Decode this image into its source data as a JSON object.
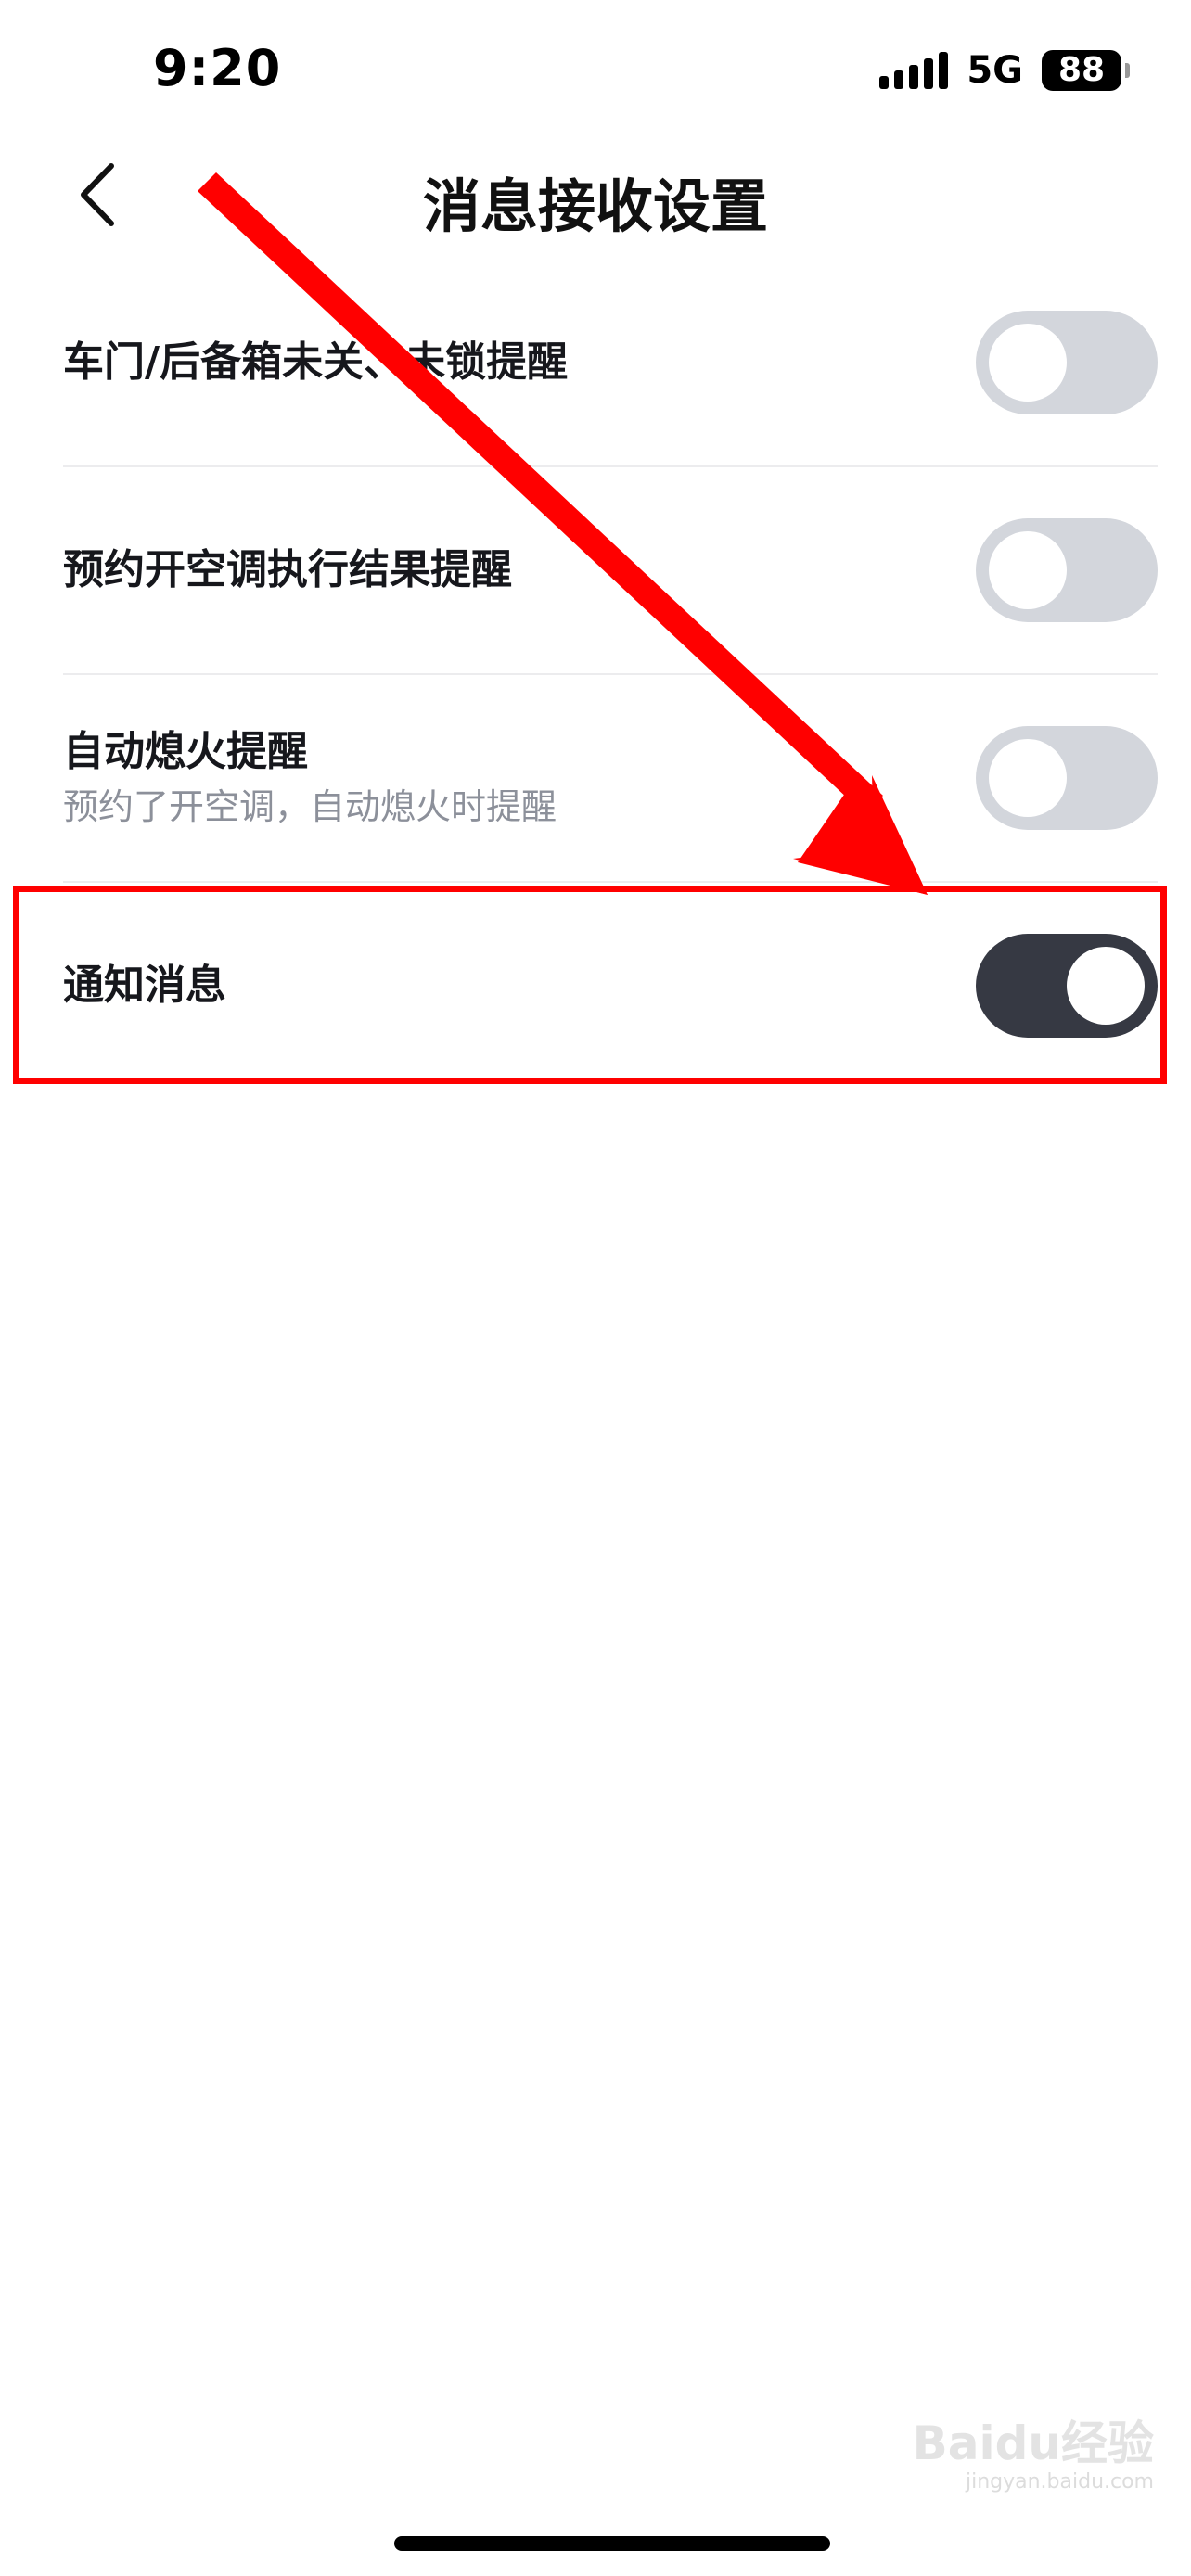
{
  "status_bar": {
    "time": "9:20",
    "network": "5G",
    "battery": "88"
  },
  "nav": {
    "title": "消息接收设置"
  },
  "settings": [
    {
      "title": "车门/后备箱未关、未锁提醒",
      "subtitle": "",
      "enabled": false
    },
    {
      "title": "预约开空调执行结果提醒",
      "subtitle": "",
      "enabled": false
    },
    {
      "title": "自动熄火提醒",
      "subtitle": "预约了开空调，自动熄火时提醒",
      "enabled": false
    },
    {
      "title": "通知消息",
      "subtitle": "",
      "enabled": true
    }
  ],
  "annotation": {
    "color": "#ff0000"
  },
  "colors": {
    "toggle_on": "#363943",
    "toggle_off": "#d3d6dc"
  },
  "watermark": {
    "text": "Baidu经验",
    "url": "jingyan.baidu.com"
  }
}
